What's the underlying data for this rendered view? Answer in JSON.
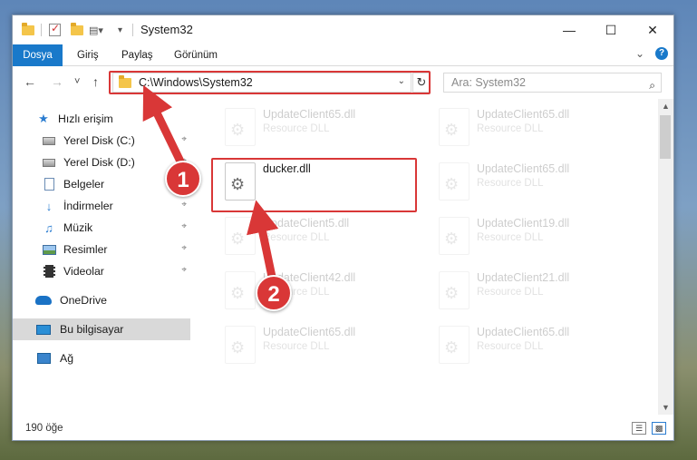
{
  "window": {
    "title": "System32",
    "controls": {
      "minimize": "—",
      "maximize": "☐",
      "close": "✕"
    }
  },
  "ribbon": {
    "tabs": [
      "Dosya",
      "Giriş",
      "Paylaş",
      "Görünüm"
    ],
    "expand": "⌄",
    "help": "?"
  },
  "navigation": {
    "back": "←",
    "forward": "→",
    "recent": "˅",
    "up": "↑",
    "address": "C:\\Windows\\System32",
    "address_chevron": "⌄",
    "refresh": "↻",
    "search_placeholder": "Ara: System32",
    "search_icon": "⌕"
  },
  "sidebar": {
    "items": [
      {
        "label": "Hızlı erişim",
        "icon": "star-icon",
        "pinned": false,
        "selected": false
      },
      {
        "label": "Yerel Disk (C:)",
        "icon": "disk-icon",
        "pinned": true,
        "selected": false
      },
      {
        "label": "Yerel Disk (D:)",
        "icon": "disk-icon",
        "pinned": true,
        "selected": false
      },
      {
        "label": "Belgeler",
        "icon": "document-icon",
        "pinned": true,
        "selected": false
      },
      {
        "label": "İndirmeler",
        "icon": "download-icon",
        "pinned": true,
        "selected": false
      },
      {
        "label": "Müzik",
        "icon": "music-icon",
        "pinned": true,
        "selected": false
      },
      {
        "label": "Resimler",
        "icon": "pictures-icon",
        "pinned": true,
        "selected": false
      },
      {
        "label": "Videolar",
        "icon": "video-icon",
        "pinned": true,
        "selected": false
      },
      {
        "label": "OneDrive",
        "icon": "cloud-icon",
        "pinned": false,
        "selected": false
      },
      {
        "label": "Bu bilgisayar",
        "icon": "computer-icon",
        "pinned": false,
        "selected": true
      },
      {
        "label": "Ağ",
        "icon": "network-icon",
        "pinned": false,
        "selected": false
      }
    ],
    "pin_glyph": "⌖"
  },
  "files": [
    {
      "name": "UpdateClient65.dll",
      "type": "Resource DLL",
      "faded": true
    },
    {
      "name": "UpdateClient65.dll",
      "type": "Resource DLL",
      "faded": true
    },
    {
      "name": "ducker.dll",
      "type": "",
      "faded": false
    },
    {
      "name": "UpdateClient65.dll",
      "type": "Resource DLL",
      "faded": true
    },
    {
      "name": "UpdateClient5.dll",
      "type": "Resource DLL",
      "faded": true
    },
    {
      "name": "UpdateClient19.dll",
      "type": "Resource DLL",
      "faded": true
    },
    {
      "name": "UpdateClient42.dll",
      "type": "Resource DLL",
      "faded": true
    },
    {
      "name": "UpdateClient21.dll",
      "type": "Resource DLL",
      "faded": true
    },
    {
      "name": "UpdateClient65.dll",
      "type": "Resource DLL",
      "faded": true
    },
    {
      "name": "UpdateClient65.dll",
      "type": "Resource DLL",
      "faded": true
    }
  ],
  "status": {
    "count": "190 öğe"
  },
  "annotations": {
    "badge1": "1",
    "badge2": "2",
    "color": "#d93737"
  },
  "colors": {
    "accent": "#1979ca",
    "highlight": "#d93737",
    "selected_bg": "#d9d9d9"
  }
}
